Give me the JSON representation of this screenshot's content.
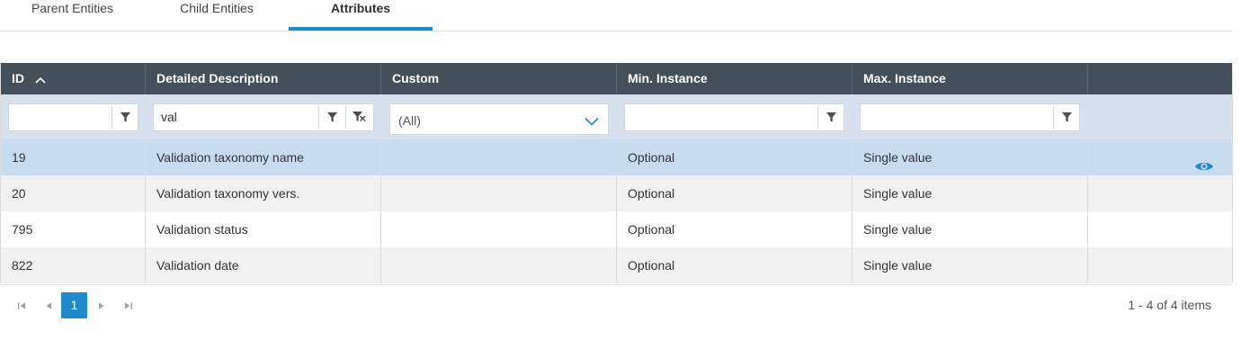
{
  "tabs": [
    {
      "label": "Parent Entities"
    },
    {
      "label": "Child Entities"
    },
    {
      "label": "Attributes"
    }
  ],
  "grid": {
    "columns": [
      {
        "label": "ID",
        "sort": "ascending"
      },
      {
        "label": "Detailed Description"
      },
      {
        "label": "Custom"
      },
      {
        "label": "Min. Instance"
      },
      {
        "label": "Max. Instance"
      },
      {
        "label": ""
      }
    ],
    "filters": {
      "id_value": "",
      "description_value": "val",
      "custom_selected": "(All)",
      "min_value": "",
      "max_value": ""
    },
    "rows": [
      {
        "id": "19",
        "description": "Validation taxonomy name",
        "custom": "",
        "min": "Optional",
        "max": "Single value",
        "selected": true
      },
      {
        "id": "20",
        "description": "Validation taxonomy vers.",
        "custom": "",
        "min": "Optional",
        "max": "Single value"
      },
      {
        "id": "795",
        "description": "Validation status",
        "custom": "",
        "min": "Optional",
        "max": "Single value"
      },
      {
        "id": "822",
        "description": "Validation date",
        "custom": "",
        "min": "Optional",
        "max": "Single value"
      }
    ]
  },
  "pager": {
    "current_page": "1",
    "info": "1 - 4 of 4 items"
  },
  "colors": {
    "accent": "#1f8ac9",
    "header_bg": "#434f59",
    "filter_bg": "#d6e1ed",
    "selected_row": "#c8dcf0",
    "alt_row": "#f1f1f1"
  },
  "icons": [
    "sort-up-icon",
    "filter-icon",
    "clear-filter-icon",
    "chevron-down-icon",
    "eye-icon",
    "first-page-icon",
    "prev-page-icon",
    "next-page-icon",
    "last-page-icon"
  ]
}
